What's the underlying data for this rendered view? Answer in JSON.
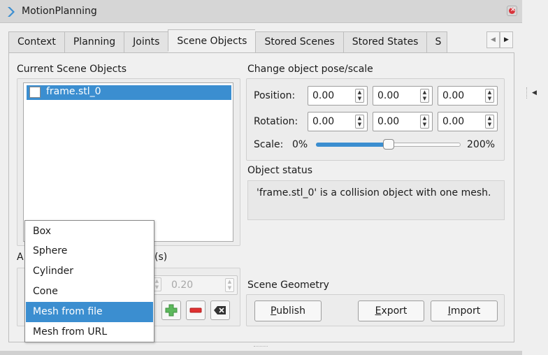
{
  "window": {
    "title": "MotionPlanning",
    "app_icon": "rviz-chevron-icon"
  },
  "tabs": [
    {
      "label": "Context",
      "active": false
    },
    {
      "label": "Planning",
      "active": false
    },
    {
      "label": "Joints",
      "active": false
    },
    {
      "label": "Scene Objects",
      "active": true
    },
    {
      "label": "Stored Scenes",
      "active": false
    },
    {
      "label": "Stored States",
      "active": false
    },
    {
      "label": "S",
      "active": false
    }
  ],
  "current_objects": {
    "title": "Current Scene Objects",
    "items": [
      {
        "label": "frame.stl_0",
        "checked": false,
        "selected": true
      }
    ]
  },
  "pose": {
    "title": "Change object pose/scale",
    "position_label": "Position:",
    "position": [
      "0.00",
      "0.00",
      "0.00"
    ],
    "rotation_label": "Rotation:",
    "rotation": [
      "0.00",
      "0.00",
      "0.00"
    ],
    "scale_label": "Scale:",
    "scale_min": "0%",
    "scale_max": "200%",
    "scale_value": 0.5
  },
  "status": {
    "title": "Object status",
    "text": "'frame.stl_0' is a collision object with one mesh."
  },
  "add_object": {
    "title_start": "A",
    "title_end": "(s)",
    "size_value": "0.20"
  },
  "geometry": {
    "title": "Scene Geometry",
    "publish": "Publish",
    "export": "Export",
    "import": "Import"
  },
  "menu": {
    "items": [
      {
        "label": "Box",
        "selected": false
      },
      {
        "label": "Sphere",
        "selected": false
      },
      {
        "label": "Cylinder",
        "selected": false
      },
      {
        "label": "Cone",
        "selected": false
      },
      {
        "label": "Mesh from file",
        "selected": true
      },
      {
        "label": "Mesh from URL",
        "selected": false
      }
    ]
  },
  "colors": {
    "accent": "#3b8ed0",
    "add": "#4caf50",
    "remove": "#e03131"
  }
}
